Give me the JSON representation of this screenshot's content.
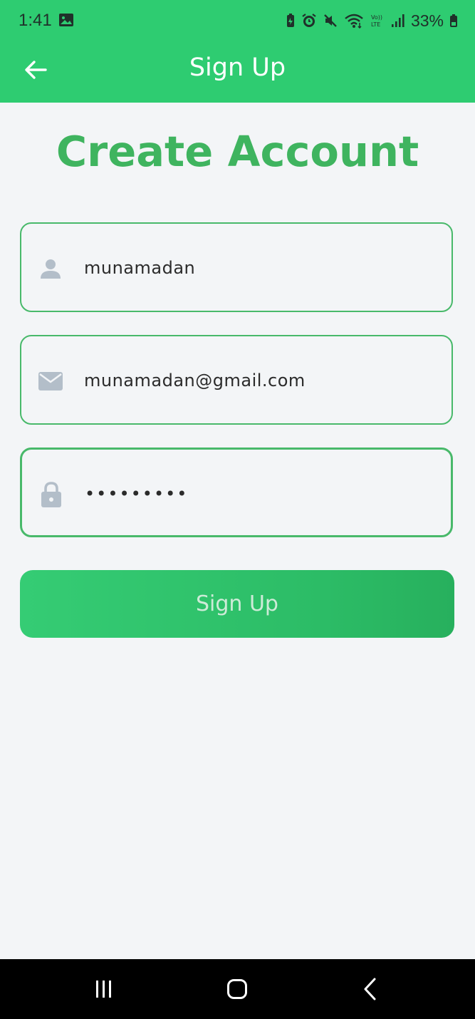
{
  "status_bar": {
    "time": "1:41",
    "battery": "33%",
    "icons": [
      "gallery-icon",
      "battery-saver-icon",
      "alarm-icon",
      "mute-icon",
      "wifi-icon",
      "volte-icon",
      "signal-icon",
      "battery-icon"
    ]
  },
  "app_bar": {
    "back_icon": "arrow-left-icon",
    "title": "Sign Up"
  },
  "page": {
    "heading": "Create Account"
  },
  "form": {
    "username": {
      "icon": "person-icon",
      "value": "munamadan"
    },
    "email": {
      "icon": "mail-icon",
      "value": "munamadan@gmail.com"
    },
    "password": {
      "icon": "lock-icon",
      "value": "•••••••••"
    },
    "submit_label": "Sign Up"
  },
  "nav": {
    "recents_icon": "recents-icon",
    "home_icon": "home-icon",
    "back_icon": "back-chevron-icon"
  },
  "colors": {
    "primary": "#2ecc71",
    "heading": "#3fb45f",
    "field_border": "#48b96a",
    "icon_grey": "#b3bec9",
    "background": "#f3f5f7"
  }
}
